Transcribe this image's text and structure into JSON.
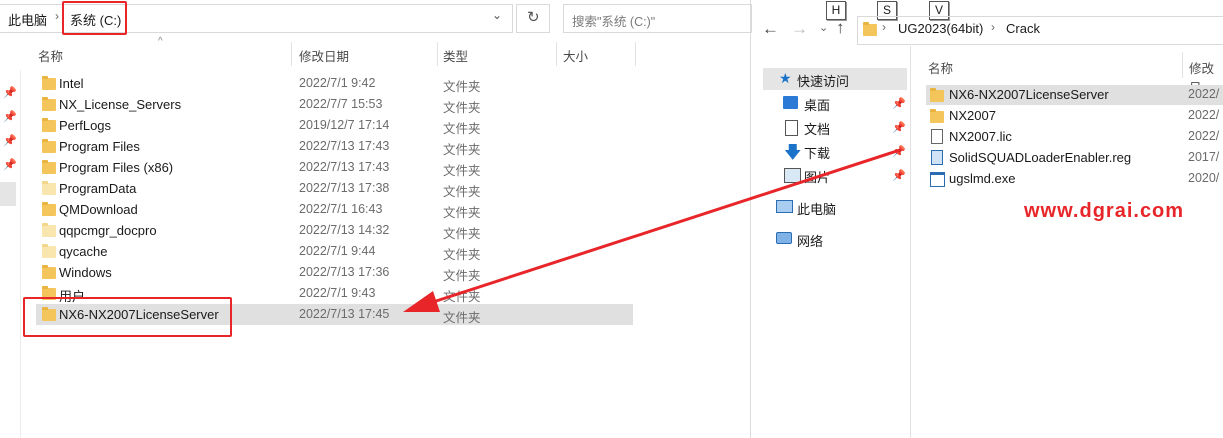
{
  "left": {
    "breadcrumb": {
      "root": "此电脑",
      "current": "系统 (C:)"
    },
    "search_placeholder": "搜索\"系统 (C:)\"",
    "columns": {
      "name": "名称",
      "date": "修改日期",
      "type": "类型",
      "size": "大小"
    },
    "rows": [
      {
        "name": "Intel",
        "date": "2022/7/1 9:42",
        "type": "文件夹"
      },
      {
        "name": "NX_License_Servers",
        "date": "2022/7/7 15:53",
        "type": "文件夹"
      },
      {
        "name": "PerfLogs",
        "date": "2019/12/7 17:14",
        "type": "文件夹"
      },
      {
        "name": "Program Files",
        "date": "2022/7/13 17:43",
        "type": "文件夹"
      },
      {
        "name": "Program Files (x86)",
        "date": "2022/7/13 17:43",
        "type": "文件夹"
      },
      {
        "name": "ProgramData",
        "date": "2022/7/13 17:38",
        "type": "文件夹"
      },
      {
        "name": "QMDownload",
        "date": "2022/7/1 16:43",
        "type": "文件夹"
      },
      {
        "name": "qqpcmgr_docpro",
        "date": "2022/7/13 14:32",
        "type": "文件夹"
      },
      {
        "name": "qycache",
        "date": "2022/7/1 9:44",
        "type": "文件夹"
      },
      {
        "name": "Windows",
        "date": "2022/7/13 17:36",
        "type": "文件夹"
      },
      {
        "name": "用户",
        "date": "2022/7/1 9:43",
        "type": "文件夹"
      },
      {
        "name": "NX6-NX2007LicenseServer",
        "date": "2022/7/13 17:45",
        "type": "文件夹"
      }
    ]
  },
  "right": {
    "keys": [
      "H",
      "S",
      "V"
    ],
    "path": [
      "UG2023(64bit)",
      "Crack"
    ],
    "nav": [
      {
        "label": "快速访问",
        "icon": "star-icon"
      },
      {
        "label": "桌面",
        "icon": "desktop-icon"
      },
      {
        "label": "文档",
        "icon": "document-icon"
      },
      {
        "label": "下载",
        "icon": "download-icon"
      },
      {
        "label": "图片",
        "icon": "picture-icon"
      },
      {
        "label": "此电脑",
        "icon": "computer-icon"
      },
      {
        "label": "网络",
        "icon": "network-icon"
      }
    ],
    "columns": {
      "name": "名称",
      "date": "修改日"
    },
    "files": [
      {
        "name": "NX6-NX2007LicenseServer",
        "date": "2022/",
        "icon": "folder-icon"
      },
      {
        "name": "NX2007",
        "date": "2022/",
        "icon": "folder-icon"
      },
      {
        "name": "NX2007.lic",
        "date": "2022/",
        "icon": "file-icon"
      },
      {
        "name": "SolidSQUADLoaderEnabler.reg",
        "date": "2017/",
        "icon": "registry-icon"
      },
      {
        "name": "ugslmd.exe",
        "date": "2020/",
        "icon": "exe-icon"
      }
    ]
  },
  "watermark": "www.dgrai.com",
  "colors": {
    "highlight": "#e5e5e5",
    "annotation": "#e8262a",
    "folder": "#f3c55a",
    "accent": "#1a73c9"
  }
}
